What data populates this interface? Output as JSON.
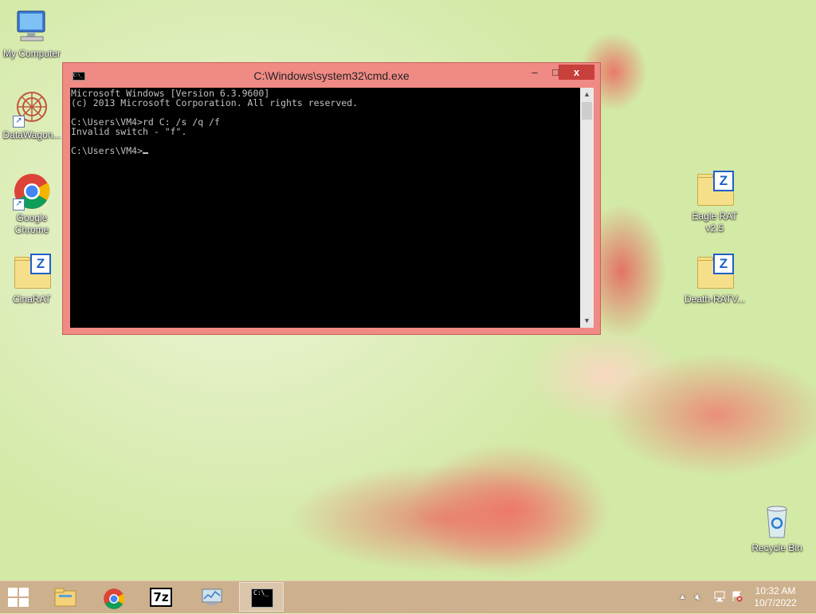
{
  "desktop": {
    "icons": [
      {
        "label": "My Computer",
        "icon": "computer-icon"
      },
      {
        "label": "DataWagon...",
        "icon": "datawagon-icon"
      },
      {
        "label": "Google Chrome",
        "icon": "chrome-icon"
      },
      {
        "label": "CinaRAT",
        "icon": "zip-folder-icon"
      },
      {
        "label": "Eagle RAT v2.5",
        "icon": "zip-folder-icon"
      },
      {
        "label": "Death-RATV...",
        "icon": "zip-folder-icon"
      },
      {
        "label": "Recycle Bin",
        "icon": "recycle-bin-icon"
      }
    ]
  },
  "cmd": {
    "title": "C:\\Windows\\system32\\cmd.exe",
    "icon_text": "C:\\_",
    "minimize": "–",
    "maximize": "□",
    "close": "x",
    "lines": [
      "Microsoft Windows [Version 6.3.9600]",
      "(c) 2013 Microsoft Corporation. All rights reserved.",
      "",
      "C:\\Users\\VM4>rd C: /s /q /f",
      "Invalid switch - \"f\".",
      "",
      "C:\\Users\\VM4>"
    ]
  },
  "taskbar": {
    "items": [
      {
        "name": "file-explorer",
        "icon": "folder-icon",
        "active": false
      },
      {
        "name": "chrome",
        "icon": "chrome-icon",
        "active": false
      },
      {
        "name": "7zip",
        "icon": "7zip-icon",
        "label": "7z",
        "active": false
      },
      {
        "name": "resource-monitor",
        "icon": "monitor-icon",
        "active": false
      },
      {
        "name": "cmd",
        "icon": "cmd-icon",
        "label": "C:\\_",
        "active": true
      }
    ],
    "tray": {
      "icons": [
        "show-hidden-icons-icon",
        "volume-muted-icon",
        "network-icon",
        "action-center-icon"
      ],
      "time": "10:32 AM",
      "date": "10/7/2022"
    }
  },
  "colors": {
    "window_frame": "#f08a84",
    "close_button": "#c7403c",
    "console_bg": "#000000",
    "console_fg": "#c0c0c0"
  }
}
